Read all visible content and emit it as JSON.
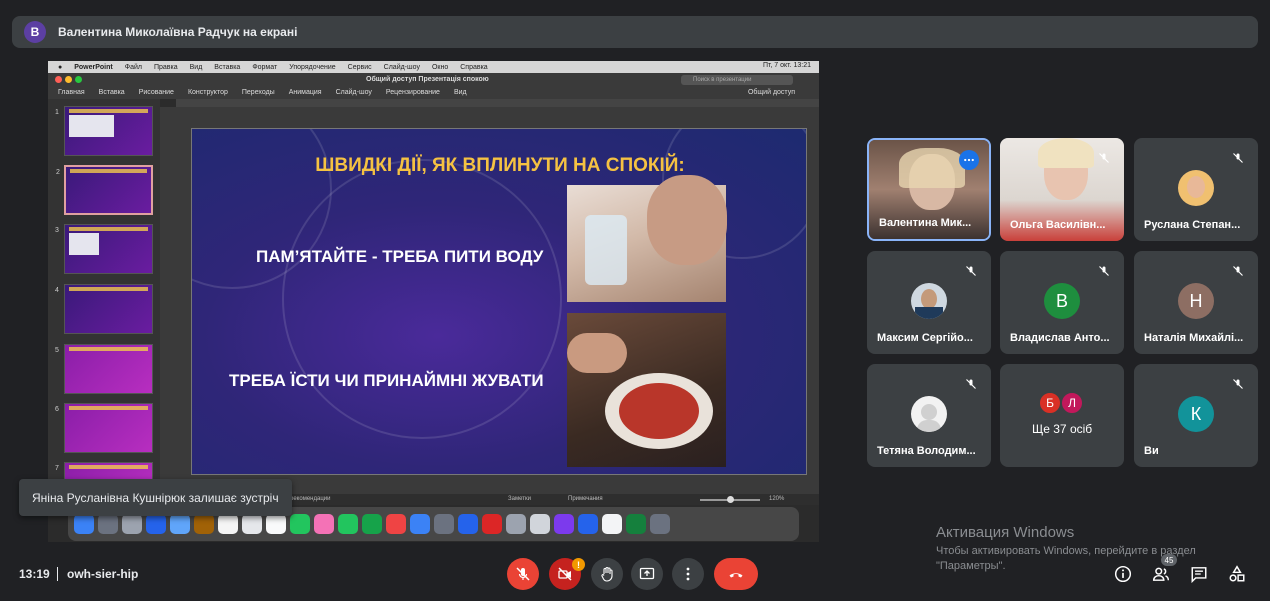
{
  "presenter_bar": {
    "avatar_letter": "В",
    "text": "Валентина Миколаївна Радчук на екрані"
  },
  "shared_screen": {
    "mac_menu": [
      "PowerPoint",
      "Файл",
      "Правка",
      "Вид",
      "Вставка",
      "Формат",
      "Упорядочение",
      "Сервис",
      "Слайд-шоу",
      "Окно",
      "Справка"
    ],
    "clock_text": "Пт, 7 окт.  13:21",
    "doc_title": "Общий доступ Презентація спокою",
    "search_placeholder": "Поиск в презентации",
    "ribbon_tabs": [
      "Главная",
      "Вставка",
      "Рисование",
      "Конструктор",
      "Переходы",
      "Анимация",
      "Слайд-шоу",
      "Рецензирование",
      "Вид"
    ],
    "share_label": "Общий доступ",
    "thumb_numbers": [
      "1",
      "2",
      "3",
      "4",
      "5",
      "6",
      "7"
    ],
    "status_left": "рекомендации",
    "notes_label": "Заметки",
    "comments_label": "Примечания",
    "zoom": "120%",
    "slide": {
      "title": "ШВИДКІ ДІЇ, ЯК ВПЛИНУТИ НА СПОКІЙ:",
      "line1": "ПАМ’ЯТАЙТЕ -  ТРЕБА ПИТИ ВОДУ",
      "line2": "ТРЕБА ЇСТИ ЧИ ПРИНАЙМНІ ЖУВАТИ"
    }
  },
  "toast": "Яніна Русланівна Кушнірюк залишає зустріч",
  "participants": [
    {
      "name": "Валентина Мик...",
      "type": "video",
      "active": true
    },
    {
      "name": "Ольга Василівн...",
      "type": "video",
      "muted": true
    },
    {
      "name": "Руслана Степан...",
      "type": "photo",
      "muted": true
    },
    {
      "name": "Максим Сергійо...",
      "type": "photo",
      "muted": true
    },
    {
      "name": "Владислав Анто...",
      "type": "letter",
      "letter": "В",
      "color": "#1e8e3e",
      "muted": true
    },
    {
      "name": "Наталія Михайлі...",
      "type": "letter",
      "letter": "Н",
      "color": "#8d6e63",
      "muted": true
    },
    {
      "name": "Тетяна Володим...",
      "type": "photo",
      "muted": true
    },
    {
      "name": "Ще 37 осіб",
      "type": "group",
      "letters": [
        "Б",
        "Л"
      ],
      "colors": [
        "#d93025",
        "#c2185b"
      ]
    },
    {
      "name": "Ви",
      "type": "letter",
      "letter": "К",
      "color": "#12939a",
      "muted": true
    }
  ],
  "watermark": {
    "title": "Активация Windows",
    "sub": "Чтобы активировать Windows, перейдите в раздел \"Параметры\"."
  },
  "bottom_bar": {
    "time": "13:19",
    "meeting_code": "owh-sier-hip",
    "camera_badge": "!",
    "people_count": "45"
  },
  "colors": {
    "accent": "#8ab4f8",
    "danger": "#ea4335",
    "bg": "#202124",
    "tile": "#3c4043"
  },
  "icons": [
    "mic-off-icon",
    "camera-off-icon",
    "raise-hand-icon",
    "present-icon",
    "more-icon",
    "hangup-icon",
    "info-icon",
    "people-icon",
    "chat-icon",
    "activities-icon"
  ]
}
